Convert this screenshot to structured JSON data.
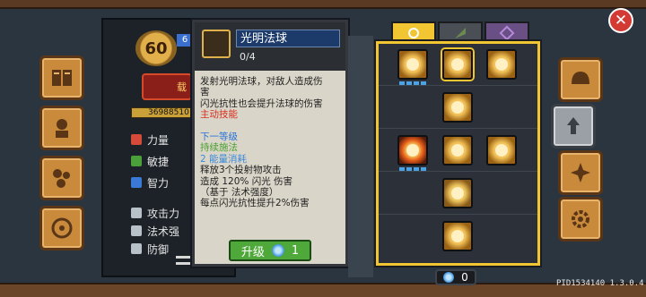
{
  "close_label": "✕",
  "left_sidebar": [
    {
      "name": "book-icon"
    },
    {
      "name": "character-icon"
    },
    {
      "name": "gear-cluster-icon"
    },
    {
      "name": "wheel-icon"
    }
  ],
  "right_sidebar": [
    {
      "name": "helmet-icon"
    },
    {
      "name": "skill-upgrade-icon"
    },
    {
      "name": "emblem-icon"
    },
    {
      "name": "cog-icon"
    }
  ],
  "character": {
    "level": "60",
    "mini_badge": "6",
    "banner_text": "载",
    "exp_value": "36988510",
    "stats": [
      {
        "label": "力量",
        "color": "#d64a3a"
      },
      {
        "label": "敏捷",
        "color": "#4aa03a"
      },
      {
        "label": "智力",
        "color": "#3a7ad6"
      }
    ],
    "lower_stats": [
      {
        "label": "攻击力"
      },
      {
        "label": "法术强"
      },
      {
        "label": "防御"
      }
    ]
  },
  "tooltip": {
    "skill_name": "光明法球",
    "progress": "0/4",
    "lines": [
      {
        "text": "发射光明法球，对敌人造成伤",
        "cls": "c-dark"
      },
      {
        "text": "害",
        "cls": "c-dark"
      },
      {
        "text": "闪光抗性也会提升法球的伤害",
        "cls": "c-dark"
      },
      {
        "text": "主动技能",
        "cls": "c-red"
      },
      {
        "text": "",
        "cls": "c-dark"
      },
      {
        "text": "下一等级",
        "cls": "c-blue"
      },
      {
        "text": "持续施法",
        "cls": "c-green"
      },
      {
        "text": "2 能量消耗",
        "cls": "c-ltblue"
      },
      {
        "text": "释放3个投射物攻击",
        "cls": "c-dark"
      },
      {
        "text": "造成 120% 闪光 伤害",
        "cls": "c-dark"
      },
      {
        "text": "（基于 法术强度）",
        "cls": "c-dark"
      },
      {
        "text": "每点闪光抗性提升2%伤害",
        "cls": "c-dark"
      }
    ],
    "upgrade_label": "升级",
    "upgrade_cost": "1"
  },
  "tabs": [
    {
      "name": "tab-light",
      "state": "active"
    },
    {
      "name": "tab-nature",
      "state": "dim"
    },
    {
      "name": "tab-shadow",
      "state": "purple"
    }
  ],
  "gem_count": "0",
  "version": "PID1534140 1.3.0.4",
  "colors": {
    "accent_gold": "#f2c533",
    "upgrade_green": "#4fa83a",
    "close_red": "#d43a34"
  }
}
